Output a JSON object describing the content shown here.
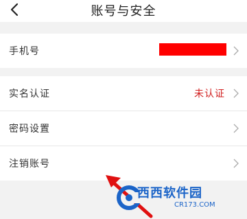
{
  "header": {
    "title": "账号与安全"
  },
  "rows": [
    {
      "label": "手机号",
      "value": ""
    },
    {
      "label": "实名认证",
      "value": "未认证",
      "value_color": "#d11f1f"
    },
    {
      "label": "密码设置",
      "value": ""
    },
    {
      "label": "注销账号",
      "value": ""
    }
  ],
  "watermark": {
    "text": "西西软件园",
    "domain": "CR173.COM"
  },
  "colors": {
    "accent_red": "#d11f1f",
    "redaction": "#ff0000",
    "background_gray": "#f2f2f2",
    "watermark_blue": "#1b64c8"
  },
  "icons": {
    "back": "chevron-left-icon",
    "chevron": "chevron-right-icon"
  }
}
